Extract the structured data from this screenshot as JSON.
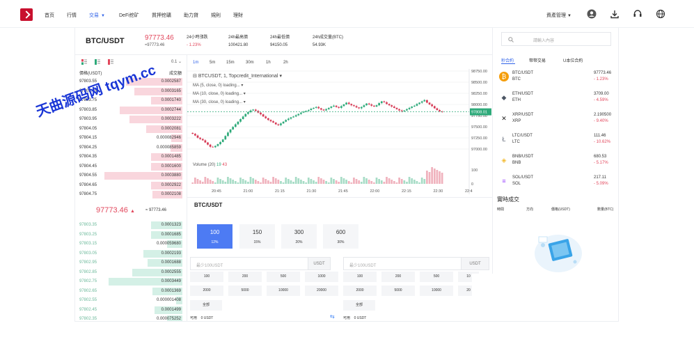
{
  "nav": {
    "items": [
      "首页",
      "行情",
      "交易",
      "DeFi挖矿",
      "質押挖礦",
      "助力貸",
      "規則",
      "理財"
    ],
    "active_index": 2,
    "asset_menu": "資產管理",
    "icons": [
      "user-icon",
      "download-icon",
      "headset-icon",
      "globe-icon"
    ]
  },
  "market": {
    "pair": "BTC/USDT",
    "last_price": "97773.46",
    "last_price_sub": "≈97773.46",
    "stats": [
      {
        "label": "24小時漲跌",
        "value": "- 1.23%",
        "down": true
      },
      {
        "label": "24h最高價",
        "value": "100421.80",
        "down": false
      },
      {
        "label": "24h最低價",
        "value": "94150.05",
        "down": false
      },
      {
        "label": "24h成交量(BTC)",
        "value": "54.93K",
        "down": false
      }
    ]
  },
  "orderbook": {
    "precision": "0.1",
    "col_price": "價格(USDT)",
    "col_amount": "成交額",
    "asks": [
      {
        "price": "97803.55",
        "amount": "0.0002587",
        "fill": 0.72
      },
      {
        "price": "97803.65",
        "amount": "0.0003165",
        "fill": 0.62
      },
      {
        "price": "97803.75",
        "amount": "0.0001740",
        "fill": 0.4
      },
      {
        "price": "97803.85",
        "amount": "0.0002744",
        "fill": 0.8
      },
      {
        "price": "97803.95",
        "amount": "0.0003222",
        "fill": 0.68
      },
      {
        "price": "97804.05",
        "amount": "0.0002081",
        "fill": 0.46
      },
      {
        "price": "97804.15",
        "amount": "0.000082946",
        "fill": 0.14
      },
      {
        "price": "97804.25",
        "amount": "0.000085859",
        "fill": 0.15
      },
      {
        "price": "97804.35",
        "amount": "0.0001485",
        "fill": 0.4
      },
      {
        "price": "97804.45",
        "amount": "0.0001600",
        "fill": 0.4
      },
      {
        "price": "97804.55",
        "amount": "0.0003880",
        "fill": 1.0
      },
      {
        "price": "97804.65",
        "amount": "0.0002922",
        "fill": 0.4
      },
      {
        "price": "97804.75",
        "amount": "0.0002108",
        "fill": 0.38
      }
    ],
    "mid_price": "97773.46",
    "mid_sub": "≈ 97773.46",
    "bids": [
      {
        "price": "97803.35",
        "amount": "0.0001323",
        "fill": 0.4
      },
      {
        "price": "97803.25",
        "amount": "0.0001685",
        "fill": 0.4
      },
      {
        "price": "97803.15",
        "amount": "0.000059680",
        "fill": 0.2
      },
      {
        "price": "97803.05",
        "amount": "0.0002193",
        "fill": 0.5
      },
      {
        "price": "97802.95",
        "amount": "0.0001688",
        "fill": 0.45
      },
      {
        "price": "97802.85",
        "amount": "0.0002555",
        "fill": 0.64
      },
      {
        "price": "97802.75",
        "amount": "0.0003449",
        "fill": 0.95
      },
      {
        "price": "97802.65",
        "amount": "0.0001369",
        "fill": 0.38
      },
      {
        "price": "97802.55",
        "amount": "0.000001408",
        "fill": 0.08
      },
      {
        "price": "97802.45",
        "amount": "0.0001499",
        "fill": 0.36
      },
      {
        "price": "97802.35",
        "amount": "0.000075252",
        "fill": 0.2
      }
    ]
  },
  "chart": {
    "timeframes": [
      "1m",
      "5m",
      "15m",
      "30m",
      "1h",
      "2h"
    ],
    "active_tf": 0,
    "symbol_line": "BTCUSDT, 1, Topcredit_International",
    "ma_lines": [
      "MA (5, close, 0)  loading...",
      "MA (10, close, 0)  loading...",
      "MA (30, close, 0)  loading..."
    ],
    "volume_label": "Volume (20)",
    "volume_v1": "19",
    "volume_v2": "43",
    "current_price_tag": "97808.01"
  },
  "chart_data": {
    "type": "candlestick",
    "x_ticks": [
      "20:45",
      "21:00",
      "21:15",
      "21:30",
      "21:45",
      "22:00",
      "22:15",
      "22:30",
      "22:4"
    ],
    "y_ticks": [
      "98750.00",
      "98500.00",
      "98250.00",
      "98000.00",
      "97750.00",
      "97500.00",
      "97250.00",
      "97000.00"
    ],
    "ylim": [
      96900,
      98800
    ],
    "volume_ticks": [
      "100",
      "0"
    ],
    "current_price": 97808.01,
    "close_path": [
      97300,
      97260,
      97210,
      97180,
      97150,
      97100,
      97050,
      97000,
      96990,
      97020,
      97060,
      97110,
      97170,
      97250,
      97330,
      97400,
      97460,
      97520,
      97580,
      97640,
      97700,
      97760,
      97800,
      97840,
      97860,
      97830,
      97790,
      97750,
      97700,
      97660,
      97620,
      97590,
      97560,
      97520,
      97500,
      97540,
      97580,
      97620,
      97650,
      97680,
      97700,
      97730,
      97760,
      97790,
      97810,
      97830,
      97850,
      97880,
      97900,
      97920,
      97890,
      97860,
      97840,
      97870,
      97900,
      97930,
      97950,
      97920,
      97900,
      97940,
      97980,
      98020,
      97990,
      97960,
      97940,
      97910,
      97890,
      97920,
      97960,
      98000,
      97980,
      97950,
      97930,
      97960,
      98010,
      98050,
      98030,
      97990,
      97960,
      97930,
      97900,
      97870,
      97840,
      97820,
      97840,
      97870,
      97900,
      97930,
      97950,
      97990,
      98020,
      98050,
      98080,
      98020,
      97980,
      97940,
      97890,
      97850,
      97820,
      97808
    ]
  },
  "trade": {
    "title": "BTC/USDT",
    "leverages": [
      {
        "amount": "100",
        "rate": "12%"
      },
      {
        "amount": "150",
        "rate": "15%"
      },
      {
        "amount": "300",
        "rate": "20%"
      },
      {
        "amount": "600",
        "rate": "30%"
      }
    ],
    "active_leverage": 0,
    "input_placeholder": "最少100USDT",
    "unit": "USDT",
    "quick_row1": [
      "100",
      "200",
      "500",
      "1000"
    ],
    "quick_row2": [
      "2000",
      "5000",
      "10000",
      "20000"
    ],
    "right_row1": [
      "100",
      "200",
      "500",
      "10"
    ],
    "right_row2": [
      "2000",
      "5000",
      "10000",
      "20"
    ],
    "all_label": "全部",
    "avail_label": "可用",
    "avail_value": "0 USDT"
  },
  "right": {
    "search_placeholder": "請輸入內容",
    "tabs": [
      "秒合約",
      "幣幣交易",
      "U本位合約"
    ],
    "active_tab": 0,
    "coins": [
      {
        "pair": "BTC/USDT",
        "sym": "BTC",
        "price": "97773.46",
        "change": "- 1.23%",
        "icon_color": "#f59e0b"
      },
      {
        "pair": "ETH/USDT",
        "sym": "ETH",
        "price": "3709.00",
        "change": "- 4.59%",
        "icon_color": "#4b5563"
      },
      {
        "pair": "XRP/USDT",
        "sym": "XRP",
        "price": "2.190500",
        "change": "- 9.40%",
        "icon_color": "#222222"
      },
      {
        "pair": "LTC/USDT",
        "sym": "LTC",
        "price": "111.46",
        "change": "- 10.62%",
        "icon_color": "#6b7280"
      },
      {
        "pair": "BNB/USDT",
        "sym": "BNB",
        "price": "680.53",
        "change": "- 5.17%",
        "icon_color": "#f3ba2f"
      },
      {
        "pair": "SOL/USDT",
        "sym": "SOL",
        "price": "217.11",
        "change": "- 5.09%",
        "icon_color": "#9945ff"
      }
    ],
    "deals_title": "實時成交",
    "deals_cols": [
      "時間",
      "方向",
      "價格(USDT)",
      "數量(BTC)"
    ]
  },
  "watermark": "天曲源码网 tqym.cc"
}
